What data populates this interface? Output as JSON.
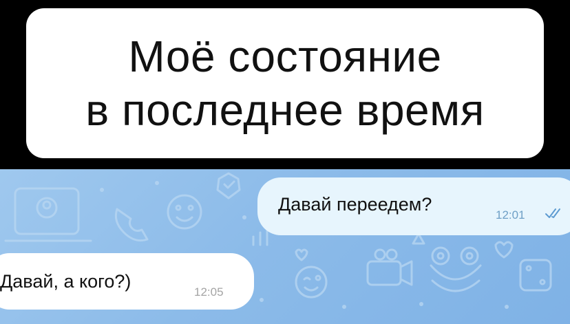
{
  "caption": {
    "line1": "Моё состояние",
    "line2": "в последнее время"
  },
  "chat": {
    "messages": [
      {
        "direction": "outgoing",
        "text": "Давай переедем?",
        "time": "12:01",
        "status_icon": "double-check-icon"
      },
      {
        "direction": "incoming",
        "text": "Давай, а кого?)",
        "time": "12:05"
      }
    ]
  },
  "colors": {
    "caption_bg": "#ffffff",
    "outgoing_bubble": "#e7f5fd",
    "incoming_bubble": "#ffffff",
    "chat_background": "#8cbbe9",
    "read_check": "#5d9bd1"
  }
}
